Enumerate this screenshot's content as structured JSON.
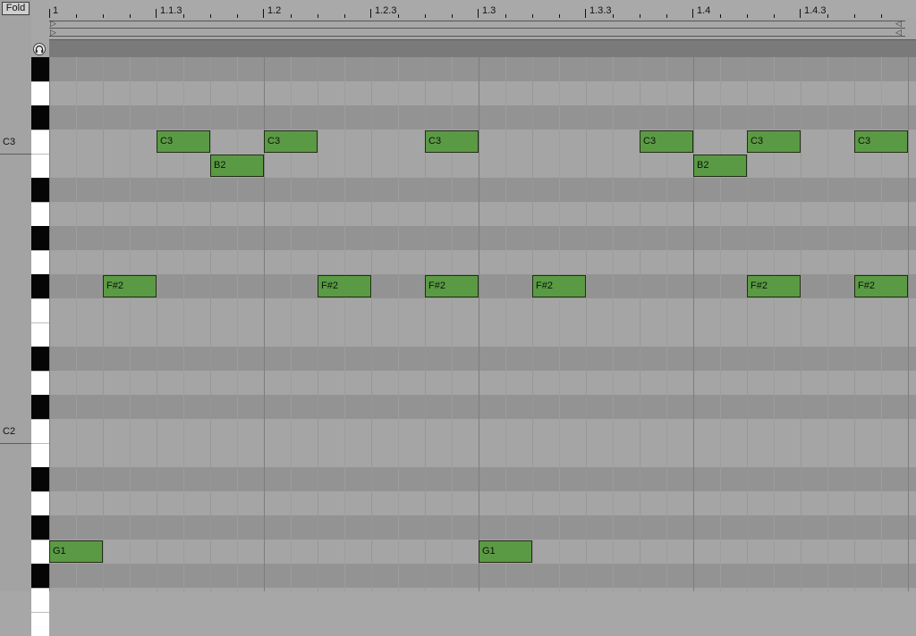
{
  "toolbar": {
    "fold_label": "Fold"
  },
  "ruler": {
    "labels": [
      "1",
      "1.1.3",
      "1.2",
      "1.2.3",
      "1.3",
      "1.3.3",
      "1.4",
      "1.4.3"
    ]
  },
  "piano_roll": {
    "pitch_top": "D#3",
    "octave_labels": [
      {
        "label": "C3",
        "pitch": "C3"
      },
      {
        "label": "C2",
        "pitch": "C2"
      }
    ],
    "note_color": "#5b9a45",
    "notes": [
      {
        "pitch": "C3",
        "label": "C3",
        "start": 1,
        "length": 1
      },
      {
        "pitch": "C3",
        "label": "C3",
        "start": 3,
        "length": 1
      },
      {
        "pitch": "C3",
        "label": "C3",
        "start": 6,
        "length": 1
      },
      {
        "pitch": "C3",
        "label": "C3",
        "start": 10,
        "length": 1
      },
      {
        "pitch": "C3",
        "label": "C3",
        "start": 12,
        "length": 1
      },
      {
        "pitch": "C3",
        "label": "C3",
        "start": 14,
        "length": 1
      },
      {
        "pitch": "B2",
        "label": "B2",
        "start": 2,
        "length": 1
      },
      {
        "pitch": "B2",
        "label": "B2",
        "start": 11,
        "length": 1
      },
      {
        "pitch": "F#2",
        "label": "F#2",
        "start": 0,
        "length": 1
      },
      {
        "pitch": "F#2",
        "label": "F#2",
        "start": 4,
        "length": 1
      },
      {
        "pitch": "F#2",
        "label": "F#2",
        "start": 6,
        "length": 1
      },
      {
        "pitch": "F#2",
        "label": "F#2",
        "start": 8,
        "length": 1
      },
      {
        "pitch": "F#2",
        "label": "F#2",
        "start": 12,
        "length": 1
      },
      {
        "pitch": "F#2",
        "label": "F#2",
        "start": 14,
        "length": 1
      },
      {
        "pitch": "G1",
        "label": "G1",
        "start": -1,
        "length": 1
      },
      {
        "pitch": "G1",
        "label": "G1",
        "start": 7,
        "length": 1
      }
    ]
  }
}
